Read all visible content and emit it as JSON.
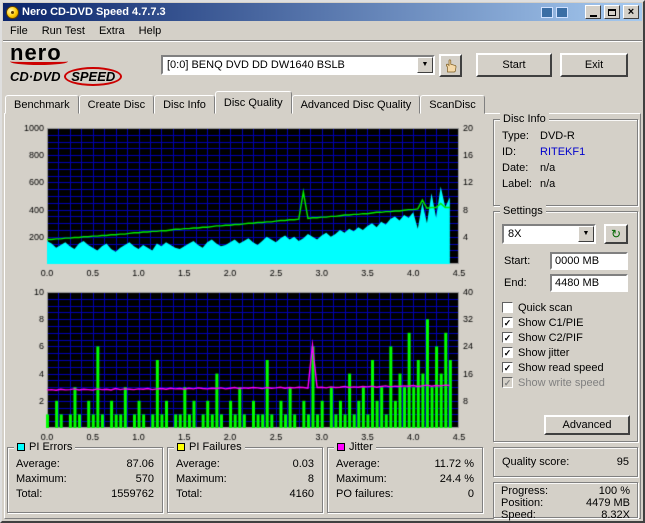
{
  "window": {
    "title": "Nero CD-DVD Speed 4.7.7.3"
  },
  "menu": {
    "items": [
      "File",
      "Run Test",
      "Extra",
      "Help"
    ]
  },
  "logo": {
    "brand": "nero",
    "product": "CD·DVD",
    "product2": "SPEED"
  },
  "toolbar": {
    "drive_select": "[0:0]   BENQ DVD DD DW1640 BSLB",
    "start_label": "Start",
    "exit_label": "Exit"
  },
  "tabs": [
    {
      "label": "Benchmark",
      "active": false
    },
    {
      "label": "Create Disc",
      "active": false
    },
    {
      "label": "Disc Info",
      "active": false
    },
    {
      "label": "Disc Quality",
      "active": true
    },
    {
      "label": "Advanced Disc Quality",
      "active": false
    },
    {
      "label": "ScanDisc",
      "active": false
    }
  ],
  "disc_info": {
    "title": "Disc Info",
    "rows": [
      {
        "label": "Type:",
        "value": "DVD-R",
        "color": "#000000"
      },
      {
        "label": "ID:",
        "value": "RITEKF1",
        "color": "#0000cc"
      },
      {
        "label": "Date:",
        "value": "n/a",
        "color": "#000000"
      },
      {
        "label": "Label:",
        "value": "n/a",
        "color": "#000000"
      }
    ]
  },
  "settings": {
    "title": "Settings",
    "speed_value": "8X",
    "start_label": "Start:",
    "start_value": "0000 MB",
    "end_label": "End:",
    "end_value": "4480 MB",
    "checkboxes": [
      {
        "label": "Quick scan",
        "checked": false,
        "disabled": false
      },
      {
        "label": "Show C1/PIE",
        "checked": true,
        "disabled": false
      },
      {
        "label": "Show C2/PIF",
        "checked": true,
        "disabled": false
      },
      {
        "label": "Show jitter",
        "checked": true,
        "disabled": false
      },
      {
        "label": "Show read speed",
        "checked": true,
        "disabled": false
      },
      {
        "label": "Show write speed",
        "checked": true,
        "disabled": true
      }
    ],
    "advanced_label": "Advanced"
  },
  "quality": {
    "label": "Quality score:",
    "value": "95"
  },
  "progress": {
    "rows": [
      {
        "label": "Progress:",
        "value": "100 %"
      },
      {
        "label": "Position:",
        "value": "4479 MB"
      },
      {
        "label": "Speed:",
        "value": "8.32X"
      }
    ]
  },
  "stats": [
    {
      "title": "PI Errors",
      "color": "#00ffff",
      "rows": [
        [
          "Average:",
          "87.06"
        ],
        [
          "Maximum:",
          "570"
        ],
        [
          "Total:",
          "1559762"
        ]
      ]
    },
    {
      "title": "PI Failures",
      "color": "#ffff00",
      "rows": [
        [
          "Average:",
          "0.03"
        ],
        [
          "Maximum:",
          "8"
        ],
        [
          "Total:",
          "4160"
        ]
      ]
    },
    {
      "title": "Jitter",
      "color": "#ff00ff",
      "rows": [
        [
          "Average:",
          "11.72 %"
        ],
        [
          "Maximum:",
          "24.4 %"
        ],
        [
          "PO failures:",
          "0"
        ]
      ]
    }
  ],
  "chart_data": [
    {
      "type": "area",
      "x_range": [
        0,
        4.5
      ],
      "left_axis": {
        "range": [
          0,
          1000
        ],
        "ticks": [
          200,
          400,
          600,
          800,
          1000
        ]
      },
      "right_axis": {
        "range": [
          0,
          20
        ],
        "ticks": [
          4,
          8,
          12,
          16,
          20
        ]
      },
      "x_ticks": [
        0,
        0.5,
        1,
        1.5,
        2,
        2.5,
        3,
        3.5,
        4,
        4.5
      ],
      "grid": {
        "x_div": 36,
        "y_div": 20,
        "color": "#0000b4"
      },
      "series": [
        {
          "name": "pi-errors",
          "kind": "area",
          "axis": "left",
          "color": "#00ffff",
          "x_start": 0,
          "x_step": 0.05,
          "values": [
            170,
            150,
            120,
            140,
            160,
            130,
            110,
            150,
            170,
            140,
            120,
            100,
            130,
            150,
            110,
            90,
            120,
            140,
            160,
            130,
            110,
            140,
            120,
            100,
            150,
            130,
            160,
            140,
            120,
            110,
            130,
            150,
            170,
            140,
            120,
            160,
            180,
            150,
            130,
            140,
            160,
            180,
            150,
            170,
            190,
            160,
            140,
            170,
            200,
            180,
            160,
            190,
            210,
            180,
            200,
            170,
            190,
            220,
            200,
            180,
            210,
            230,
            200,
            220,
            250,
            230,
            260,
            240,
            270,
            250,
            280,
            300,
            270,
            310,
            290,
            330,
            350,
            320,
            360,
            340,
            380,
            260,
            450,
            300,
            520,
            340,
            570,
            420,
            490
          ]
        },
        {
          "name": "read-speed",
          "kind": "line",
          "axis": "right",
          "color": "#00ee00",
          "x_start": 0,
          "x_step": 0.05,
          "values": [
            3.6,
            3.6,
            3.7,
            3.7,
            3.8,
            3.8,
            3.9,
            3.9,
            4.0,
            4.0,
            4.1,
            4.1,
            4.2,
            4.2,
            4.3,
            4.3,
            4.4,
            4.4,
            4.5,
            4.6,
            4.6,
            4.7,
            4.7,
            4.8,
            4.8,
            4.9,
            4.9,
            5.0,
            5.1,
            5.1,
            5.2,
            5.2,
            5.3,
            5.3,
            5.4,
            5.4,
            5.5,
            5.6,
            5.6,
            5.7,
            5.7,
            5.8,
            5.8,
            5.9,
            6.0,
            6.0,
            6.1,
            6.1,
            6.2,
            6.2,
            6.3,
            6.4,
            6.4,
            6.5,
            6.5,
            6.6,
            10.6,
            6.7,
            6.8,
            6.8,
            6.9,
            6.9,
            7.0,
            7.0,
            7.1,
            7.2,
            7.2,
            7.3,
            7.3,
            7.4,
            7.4,
            7.5,
            7.6,
            7.6,
            7.7,
            7.7,
            7.8,
            7.8,
            7.9,
            8.0,
            8.0,
            8.1,
            9.4,
            8.2,
            8.3,
            8.3,
            8.9,
            8.3,
            8.3
          ]
        }
      ]
    },
    {
      "type": "bar",
      "x_range": [
        0,
        4.5
      ],
      "left_axis": {
        "range": [
          0,
          10
        ],
        "ticks": [
          2,
          4,
          6,
          8,
          10
        ]
      },
      "right_axis": {
        "range": [
          0,
          40
        ],
        "ticks": [
          8,
          16,
          24,
          32,
          40
        ]
      },
      "x_ticks": [
        0,
        0.5,
        1,
        1.5,
        2,
        2.5,
        3,
        3.5,
        4,
        4.5
      ],
      "grid": {
        "x_div": 36,
        "y_div": 20,
        "color": "#0000b4"
      },
      "series": [
        {
          "name": "pi-failures",
          "kind": "bars",
          "axis": "left",
          "color": "#00ff00",
          "x_start": 0,
          "x_step": 0.05,
          "values": [
            1,
            0,
            2,
            1,
            0,
            1,
            3,
            1,
            0,
            2,
            1,
            6,
            1,
            0,
            2,
            1,
            1,
            3,
            0,
            1,
            2,
            1,
            0,
            1,
            5,
            1,
            2,
            0,
            1,
            1,
            3,
            1,
            2,
            0,
            1,
            2,
            1,
            4,
            1,
            0,
            2,
            1,
            3,
            1,
            0,
            2,
            1,
            1,
            5,
            1,
            0,
            2,
            1,
            3,
            1,
            0,
            2,
            1,
            6,
            1,
            2,
            0,
            3,
            1,
            2,
            1,
            4,
            1,
            2,
            3,
            1,
            5,
            2,
            3,
            1,
            6,
            2,
            4,
            3,
            7,
            3,
            5,
            4,
            8,
            3,
            6,
            4,
            7,
            5
          ]
        },
        {
          "name": "jitter",
          "kind": "line",
          "axis": "right",
          "color": "#ff00ff",
          "x_start": 0,
          "x_step": 0.05,
          "values": [
            11.2,
            11.3,
            11.1,
            11.4,
            11.2,
            11.3,
            11.5,
            11.2,
            11.4,
            11.3,
            11.2,
            11.5,
            11.3,
            11.4,
            11.2,
            11.6,
            11.3,
            11.5,
            11.4,
            11.3,
            11.5,
            11.4,
            11.6,
            11.3,
            11.5,
            11.6,
            11.4,
            11.7,
            11.5,
            11.6,
            11.4,
            11.7,
            11.5,
            11.8,
            11.6,
            11.5,
            11.7,
            11.6,
            11.8,
            11.5,
            11.7,
            11.9,
            11.6,
            11.8,
            11.7,
            11.9,
            11.8,
            11.6,
            11.9,
            11.7,
            11.8,
            12.0,
            11.7,
            11.9,
            11.8,
            12.0,
            11.9,
            11.7,
            24.4,
            11.9,
            12.0,
            11.8,
            12.1,
            11.9,
            12.0,
            12.2,
            11.9,
            12.1,
            12.0,
            12.2,
            12.1,
            12.3,
            12.0,
            12.2,
            12.4,
            12.1,
            12.3,
            12.2,
            12.4,
            12.3,
            12.5,
            12.2,
            12.4,
            12.6,
            12.3,
            12.5,
            12.4,
            12.6,
            12.5
          ]
        }
      ]
    }
  ]
}
